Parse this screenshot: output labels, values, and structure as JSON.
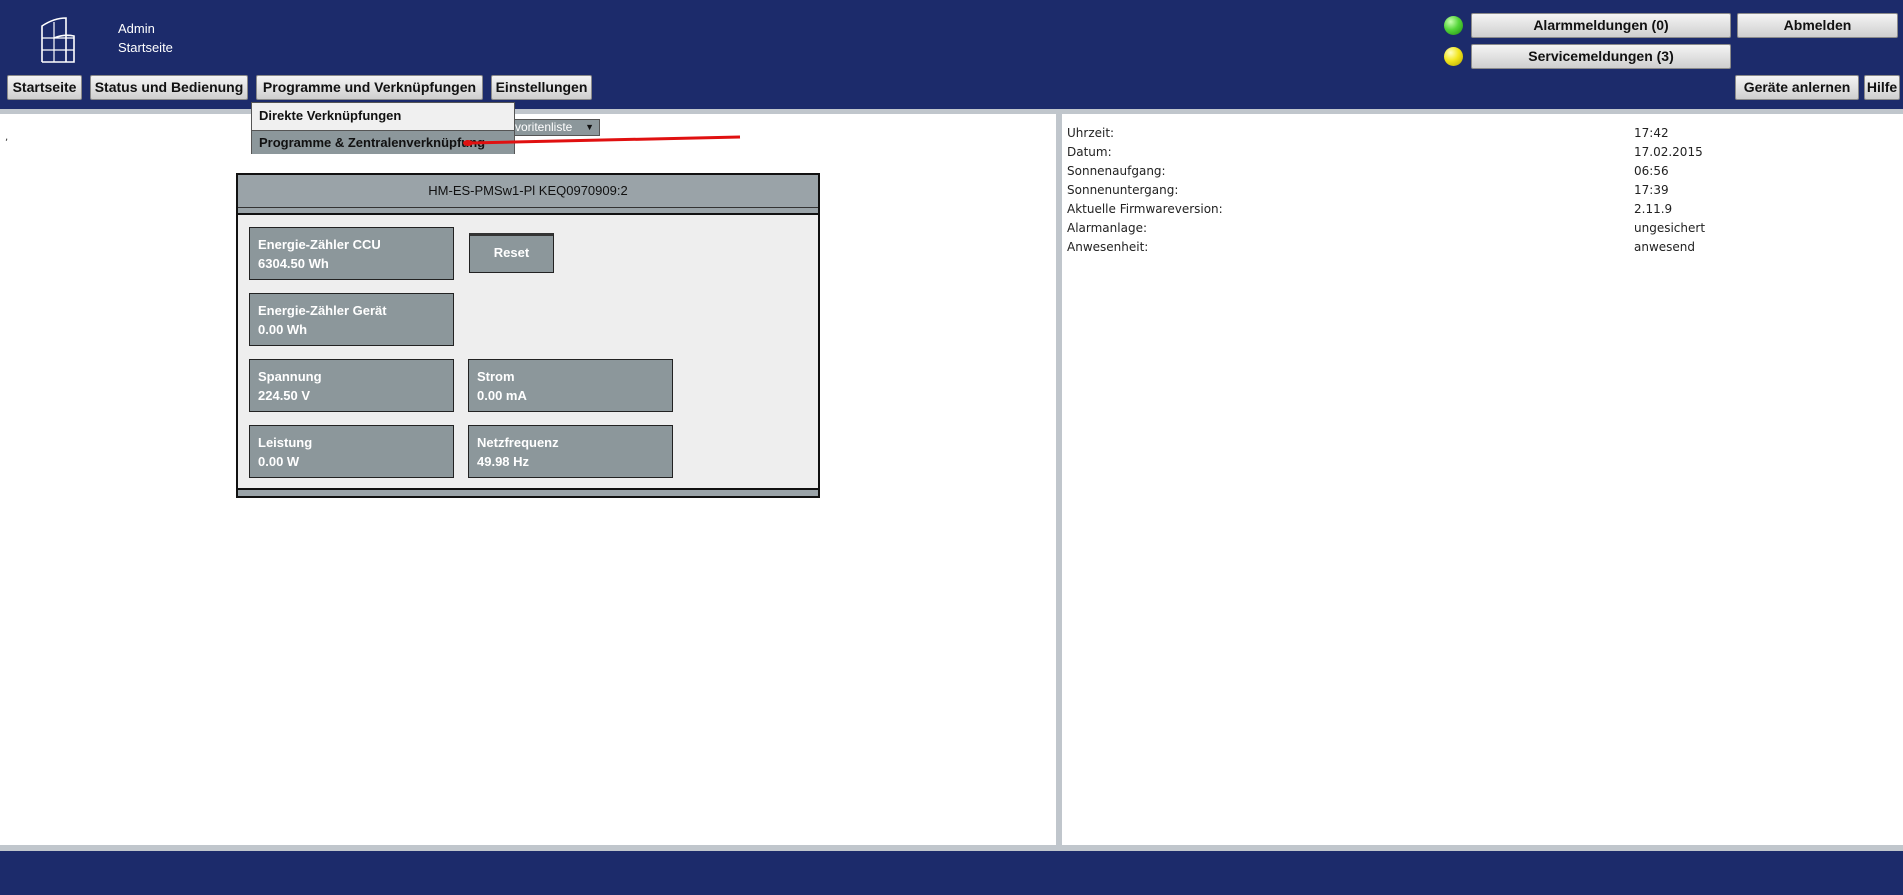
{
  "header": {
    "user": "Admin",
    "page": "Startseite",
    "nav": [
      "Startseite",
      "Status und Bedienung",
      "Programme und Verknüpfungen",
      "Einstellungen"
    ],
    "alarm_label": "Alarmmeldungen (0)",
    "service_label": "Servicemeldungen (3)",
    "logout_label": "Abmelden",
    "learn_devices_label": "Geräte anlernen",
    "help_label": "Hilfe",
    "alarm_led_color": "#55d63a",
    "service_led_color": "#f2e61e"
  },
  "menu": {
    "items": [
      "Direkte Verknüpfungen",
      "Programme & Zentralenverknüpfung"
    ]
  },
  "favorites": {
    "label": "voritenliste"
  },
  "device": {
    "title": "HM-ES-PMSw1-Pl KEQ0970909:2",
    "tiles": [
      {
        "label": "Energie-Zähler CCU",
        "value": "6304.50 Wh"
      },
      {
        "label": "Energie-Zähler Gerät",
        "value": "0.00 Wh"
      },
      {
        "label": "Spannung",
        "value": "224.50 V"
      },
      {
        "label": "Strom",
        "value": "0.00 mA"
      },
      {
        "label": "Leistung",
        "value": "0.00 W"
      },
      {
        "label": "Netzfrequenz",
        "value": "49.98 Hz"
      }
    ],
    "reset_label": "Reset"
  },
  "info": {
    "rows": [
      {
        "label": "Uhrzeit:",
        "value": "17:42"
      },
      {
        "label": "Datum:",
        "value": "17.02.2015"
      },
      {
        "label": "Sonnenaufgang:",
        "value": "06:56"
      },
      {
        "label": "Sonnenuntergang:",
        "value": "17:39"
      },
      {
        "label": "Aktuelle Firmwareversion:",
        "value": "2.11.9"
      },
      {
        "label": "Alarmanlage:",
        "value": "ungesichert"
      },
      {
        "label": "Anwesenheit:",
        "value": "anwesend"
      }
    ]
  },
  "colors": {
    "header_bg": "#1c2b6b",
    "panel_gray": "#8c979b",
    "annotation_red": "#e01010"
  }
}
